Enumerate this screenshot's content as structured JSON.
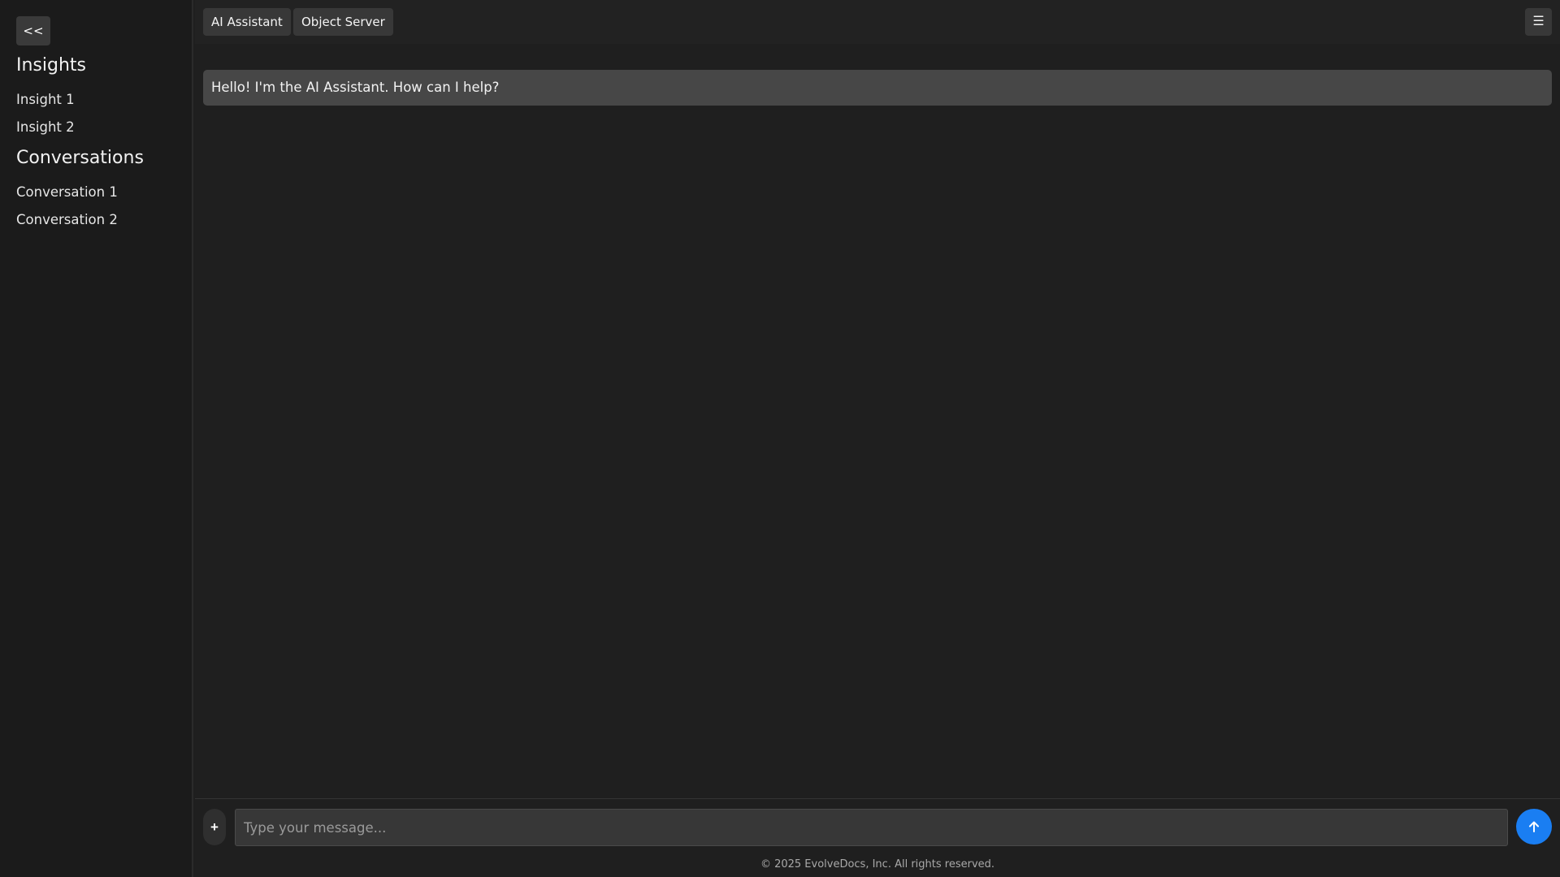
{
  "sidebar": {
    "collapse_label": "<<",
    "insights_title": "Insights",
    "insights": [
      {
        "label": "Insight 1"
      },
      {
        "label": "Insight 2"
      }
    ],
    "conversations_title": "Conversations",
    "conversations": [
      {
        "label": "Conversation 1"
      },
      {
        "label": "Conversation 2"
      }
    ]
  },
  "topbar": {
    "tabs": [
      {
        "label": "AI Assistant"
      },
      {
        "label": "Object Server"
      }
    ],
    "menu_icon": "hamburger-menu-icon",
    "menu_glyph": "☰"
  },
  "chat": {
    "messages": [
      {
        "text": "Hello! I'm the AI Assistant. How can I help?"
      }
    ]
  },
  "composer": {
    "attach_glyph": "+",
    "attach_icon": "plus-icon",
    "input_value": "",
    "placeholder": "Type your message...",
    "send_icon": "arrow-up-icon"
  },
  "footer": {
    "text": "© 2025 EvolveDocs, Inc. All rights reserved."
  },
  "colors": {
    "background": "#1f1f1f",
    "sidebar": "#1b1b1b",
    "button": "#383838",
    "message_bubble": "#474747",
    "accent": "#1a7ef2"
  }
}
